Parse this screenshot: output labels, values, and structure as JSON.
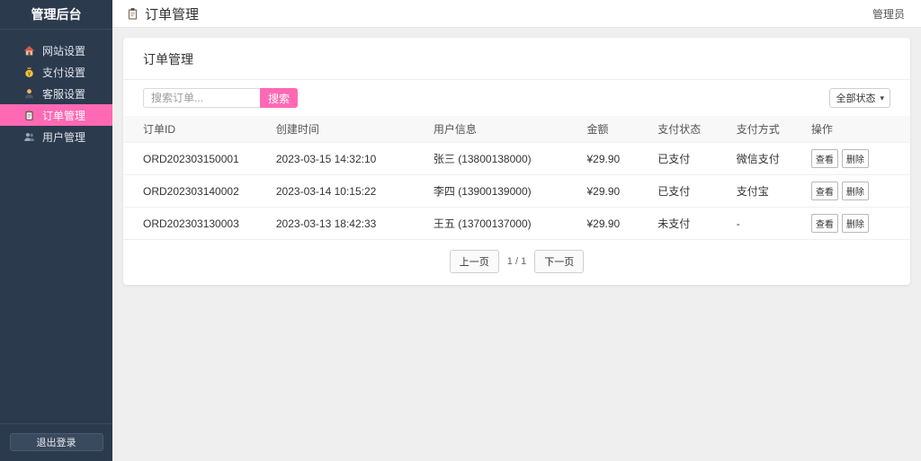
{
  "sidebar": {
    "title": "管理后台",
    "items": [
      {
        "label": "网站设置",
        "icon": "home-icon"
      },
      {
        "label": "支付设置",
        "icon": "money-bag-icon"
      },
      {
        "label": "客服设置",
        "icon": "support-person-icon"
      },
      {
        "label": "订单管理",
        "icon": "clipboard-icon",
        "active": true
      },
      {
        "label": "用户管理",
        "icon": "users-icon"
      }
    ],
    "logout_label": "退出登录"
  },
  "header": {
    "title": "订单管理",
    "user": "管理员"
  },
  "card": {
    "title": "订单管理",
    "search": {
      "placeholder": "搜索订单...",
      "button_label": "搜索"
    },
    "status_filter": {
      "selected": "全部状态"
    },
    "table": {
      "headers": [
        "订单ID",
        "创建时间",
        "用户信息",
        "金额",
        "支付状态",
        "支付方式",
        "操作"
      ],
      "rows": [
        {
          "order_id": "ORD202303150001",
          "created_at": "2023-03-15 14:32:10",
          "user_info": "张三 (13800138000)",
          "amount": "¥29.90",
          "pay_status": "已支付",
          "pay_status_type": "paid",
          "pay_method": "微信支付"
        },
        {
          "order_id": "ORD202303140002",
          "created_at": "2023-03-14 10:15:22",
          "user_info": "李四 (13900139000)",
          "amount": "¥29.90",
          "pay_status": "已支付",
          "pay_status_type": "paid",
          "pay_method": "支付宝"
        },
        {
          "order_id": "ORD202303130003",
          "created_at": "2023-03-13 18:42:33",
          "user_info": "王五 (13700137000)",
          "amount": "¥29.90",
          "pay_status": "未支付",
          "pay_status_type": "unpaid",
          "pay_method": "-"
        }
      ],
      "actions": {
        "view": "查看",
        "delete": "删除"
      }
    },
    "pagination": {
      "prev": "上一页",
      "info": "1 / 1",
      "next": "下一页"
    }
  },
  "colors": {
    "sidebar_bg": "#2c3a4e",
    "accent_pink": "#ff69b4",
    "paid_green": "#28a745",
    "unpaid_red": "#e74c3c",
    "content_bg": "#efefef"
  }
}
